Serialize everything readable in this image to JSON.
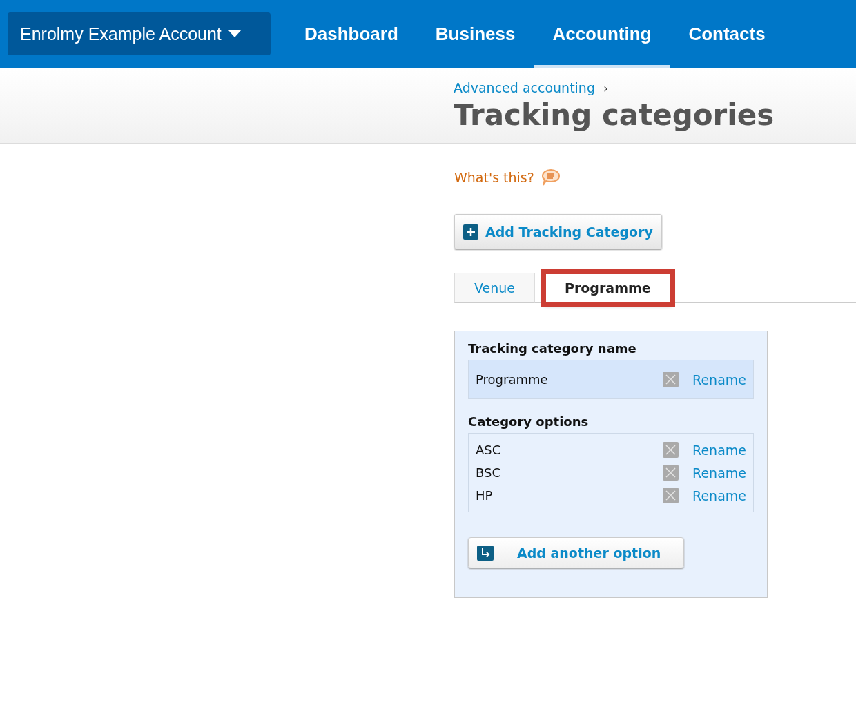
{
  "account_menu": {
    "label": "Enrolmy Example Account"
  },
  "nav": [
    {
      "label": "Dashboard",
      "selected": false
    },
    {
      "label": "Business",
      "selected": false
    },
    {
      "label": "Accounting",
      "selected": true
    },
    {
      "label": "Contacts",
      "selected": false
    }
  ],
  "breadcrumb": {
    "link": "Advanced accounting",
    "separator": "›"
  },
  "page_title": "Tracking categories",
  "help_link": "What's this?",
  "add_category_button": "Add Tracking Category",
  "tabs": [
    {
      "label": "Venue",
      "selected": false,
      "highlighted": false
    },
    {
      "label": "Programme",
      "selected": true,
      "highlighted": true
    }
  ],
  "panel": {
    "name_heading": "Tracking category name",
    "name_row": {
      "value": "Programme",
      "action": "Rename"
    },
    "options_heading": "Category options",
    "options": [
      {
        "value": "ASC",
        "action": "Rename"
      },
      {
        "value": "BSC",
        "action": "Rename"
      },
      {
        "value": "HP",
        "action": "Rename"
      }
    ],
    "add_option_button": "Add another option"
  }
}
